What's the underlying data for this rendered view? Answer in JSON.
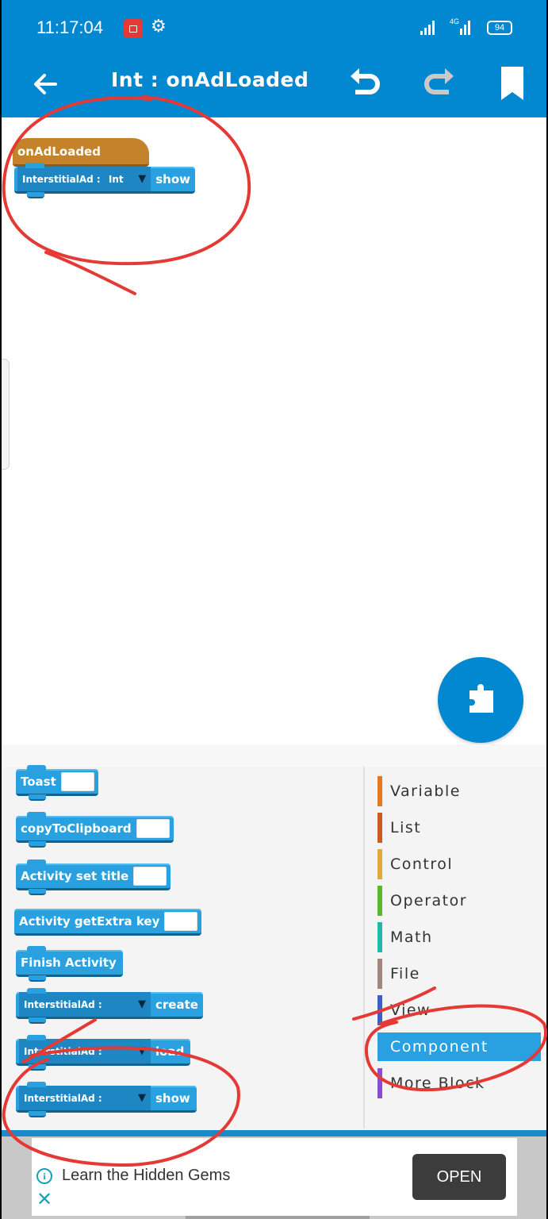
{
  "status_bar": {
    "time": "11:17:04",
    "network_label": "4G",
    "battery": "94"
  },
  "toolbar": {
    "title": "Int : onAdLoaded",
    "back_icon": "arrow-left-icon",
    "undo_icon": "undo-icon",
    "redo_icon": "redo-icon",
    "bookmark_icon": "bookmark-icon"
  },
  "canvas": {
    "event_block": {
      "label": "onAdLoaded"
    },
    "statement_block": {
      "component_label": "InterstitialAd :",
      "component_value": "Int",
      "method": "show"
    }
  },
  "fab": {
    "icon": "puzzle-icon"
  },
  "palette": {
    "blocks": [
      {
        "label": "Toast",
        "has_input": true
      },
      {
        "label": "copyToClipboard",
        "has_input": true
      },
      {
        "label": "Activity set title",
        "has_input": true
      },
      {
        "label": "Activity getExtra key",
        "has_input": true
      },
      {
        "label": "Finish Activity",
        "has_input": false
      },
      {
        "component_label": "InterstitialAd :",
        "component_value": "",
        "method": "create"
      },
      {
        "component_label": "InterstitialAd :",
        "component_value": "",
        "method": "load"
      },
      {
        "component_label": "InterstitialAd :",
        "component_value": "",
        "method": "show"
      }
    ],
    "categories": [
      {
        "label": "Variable",
        "color": "#e8781e"
      },
      {
        "label": "List",
        "color": "#cc5b22"
      },
      {
        "label": "Control",
        "color": "#e1a83a"
      },
      {
        "label": "Operator",
        "color": "#5cb72e"
      },
      {
        "label": "Math",
        "color": "#23b8a6"
      },
      {
        "label": "File",
        "color": "#a1887f"
      },
      {
        "label": "View",
        "color": "#3f5dc9"
      },
      {
        "label": "Component",
        "color": "#29a0df",
        "selected": true
      },
      {
        "label": "More Block",
        "color": "#8a4bd6"
      }
    ]
  },
  "ad": {
    "text": "Learn the Hidden Gems",
    "button": "OPEN"
  },
  "colors": {
    "primary": "#0288d1",
    "block_blue": "#29a0df",
    "event_orange": "#c4832a",
    "annotation_red": "#e53935"
  }
}
